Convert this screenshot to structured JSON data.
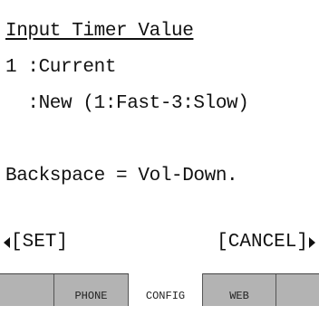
{
  "screen": {
    "title": "Input Timer Value",
    "row1": "1 :Current",
    "row2": "  :New (1:Fast-3:Slow)",
    "row3": "Backspace = Vol-Down."
  },
  "softkeys": {
    "left_label": "[SET]",
    "right_label": "[CANCEL]"
  },
  "tabs": {
    "phone": "PHONE",
    "config": "CONFIG",
    "web": "WEB"
  }
}
